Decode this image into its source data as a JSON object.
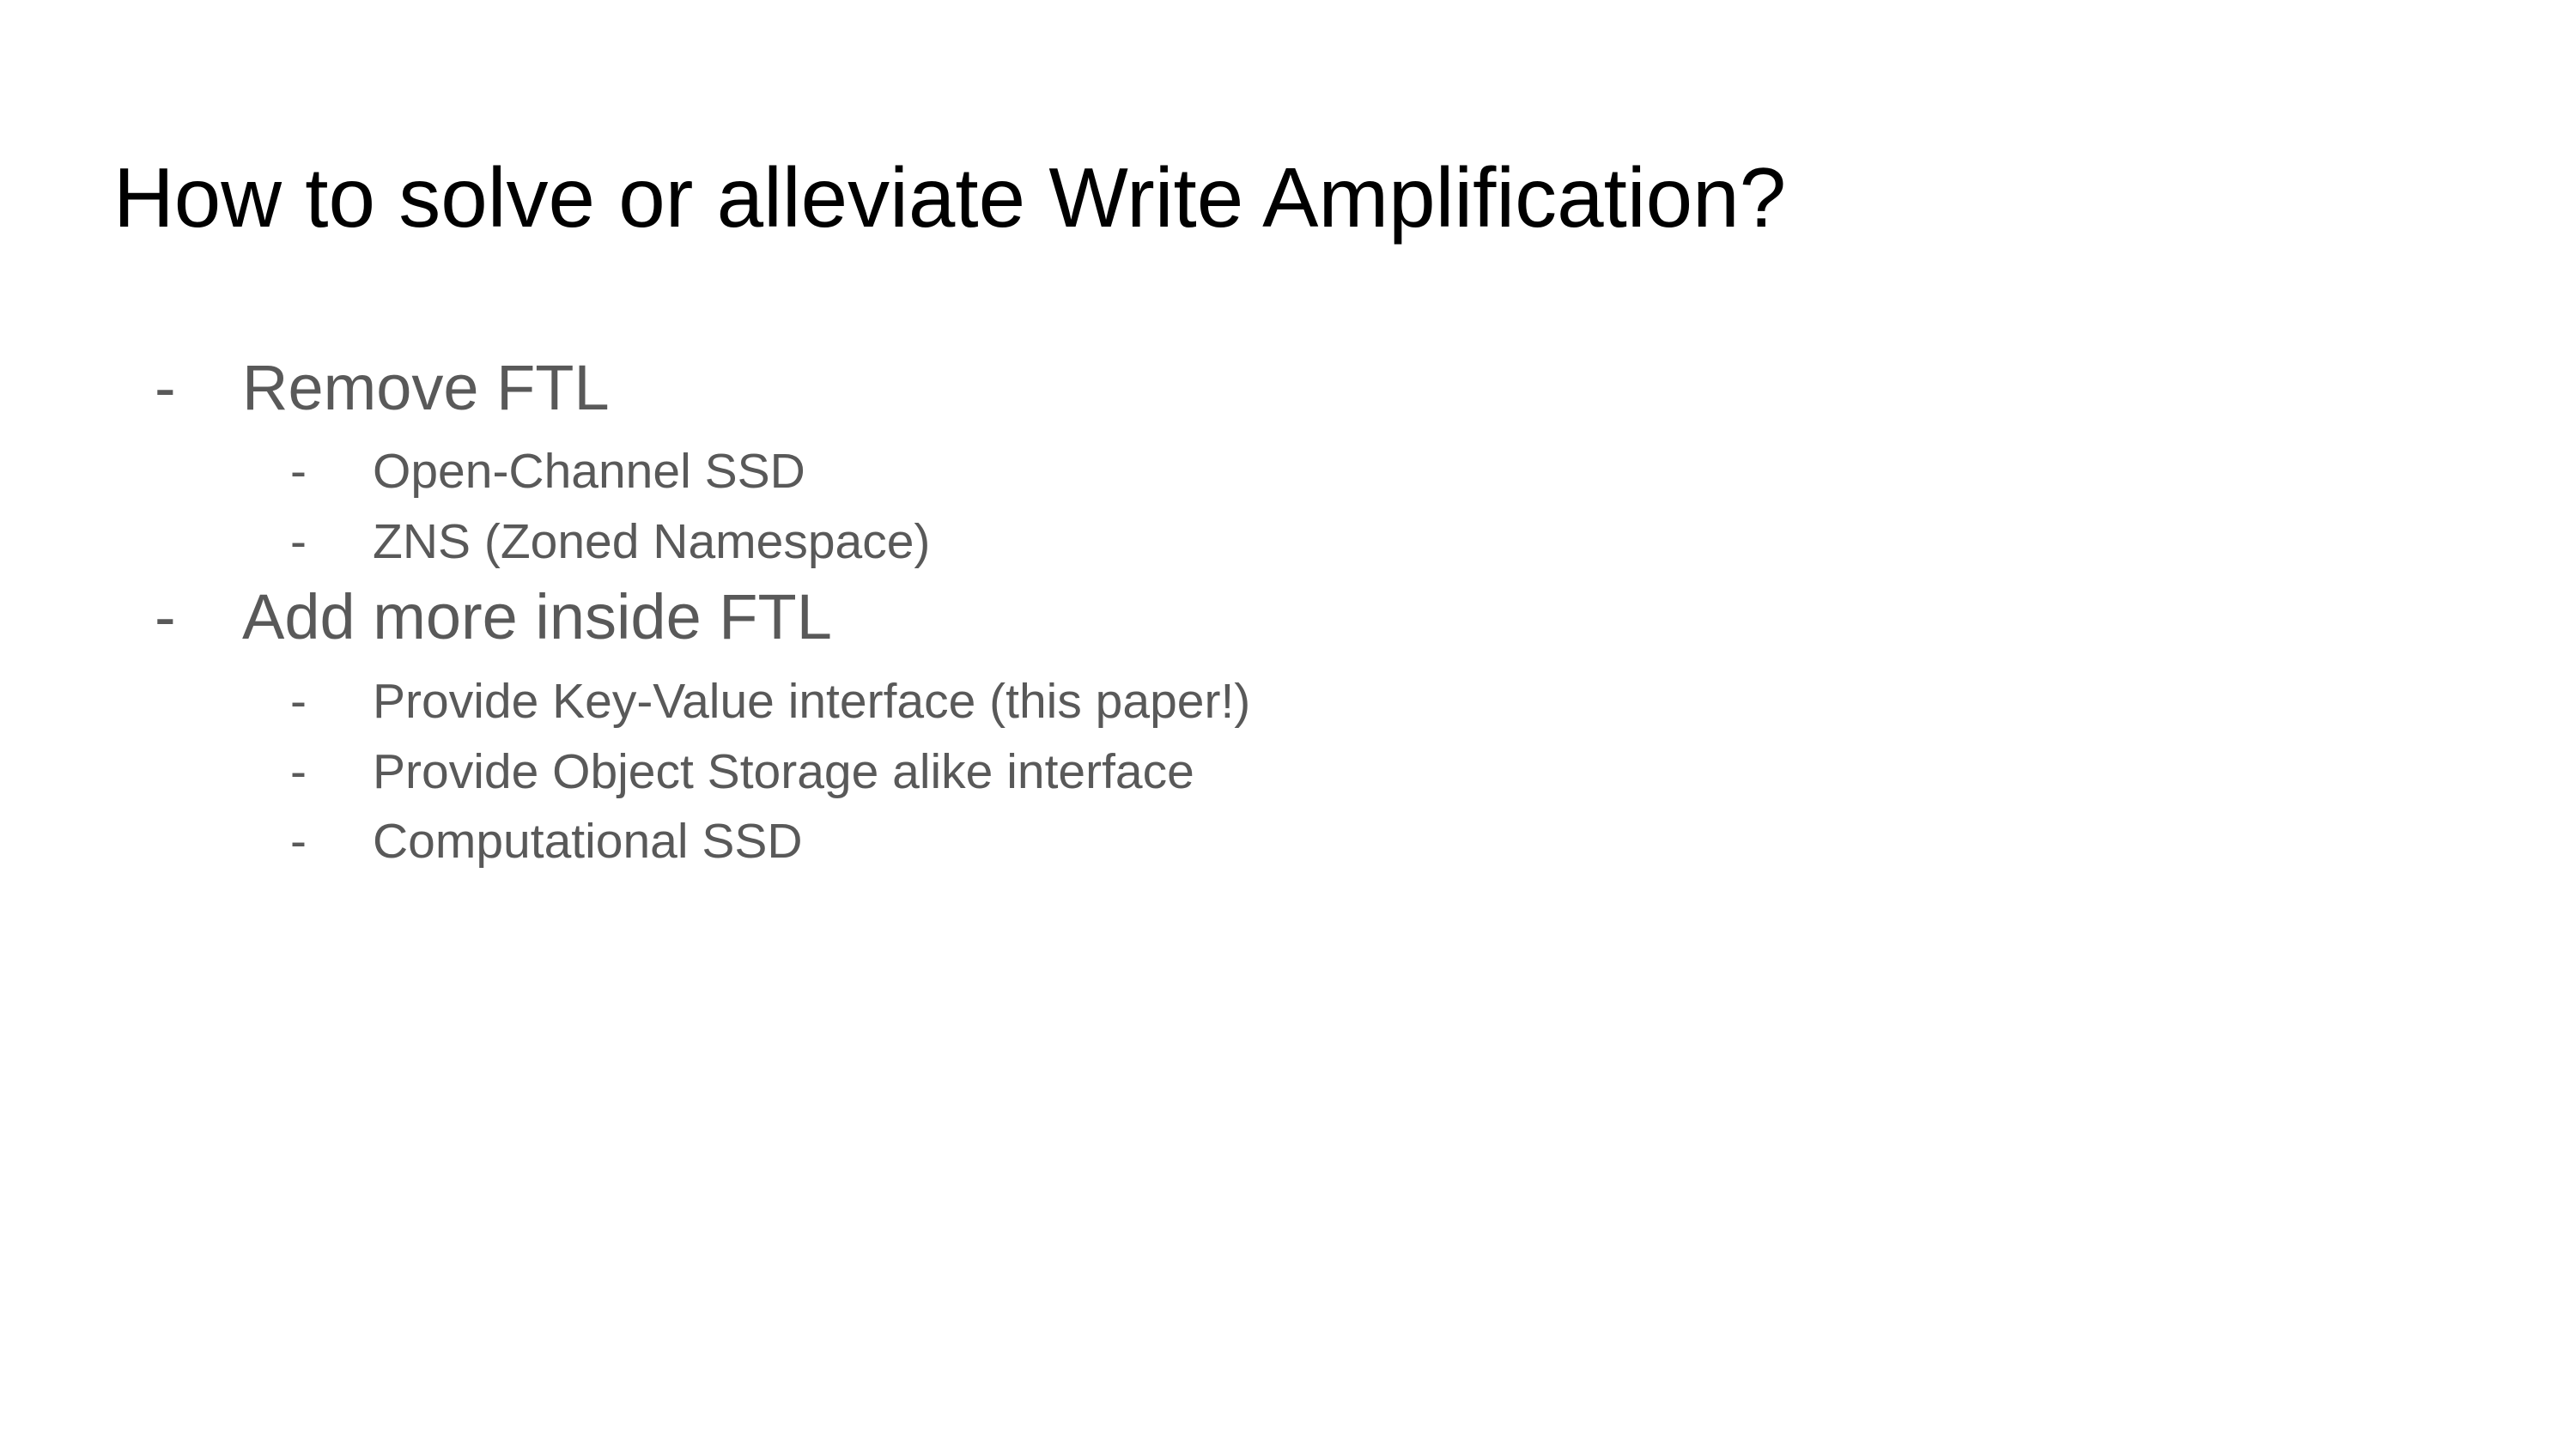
{
  "slide": {
    "title": "How to solve or alleviate Write Amplification?",
    "bullet_marker": "-",
    "items": [
      {
        "text": "Remove FTL",
        "level": 1
      },
      {
        "text": "Open-Channel SSD",
        "level": 2
      },
      {
        "text": "ZNS (Zoned Namespace)",
        "level": 2
      },
      {
        "text": "Add more inside FTL",
        "level": 1
      },
      {
        "text": "Provide Key-Value interface (this paper!)",
        "level": 2
      },
      {
        "text": "Provide Object Storage alike interface",
        "level": 2
      },
      {
        "text": "Computational SSD",
        "level": 2
      }
    ]
  }
}
